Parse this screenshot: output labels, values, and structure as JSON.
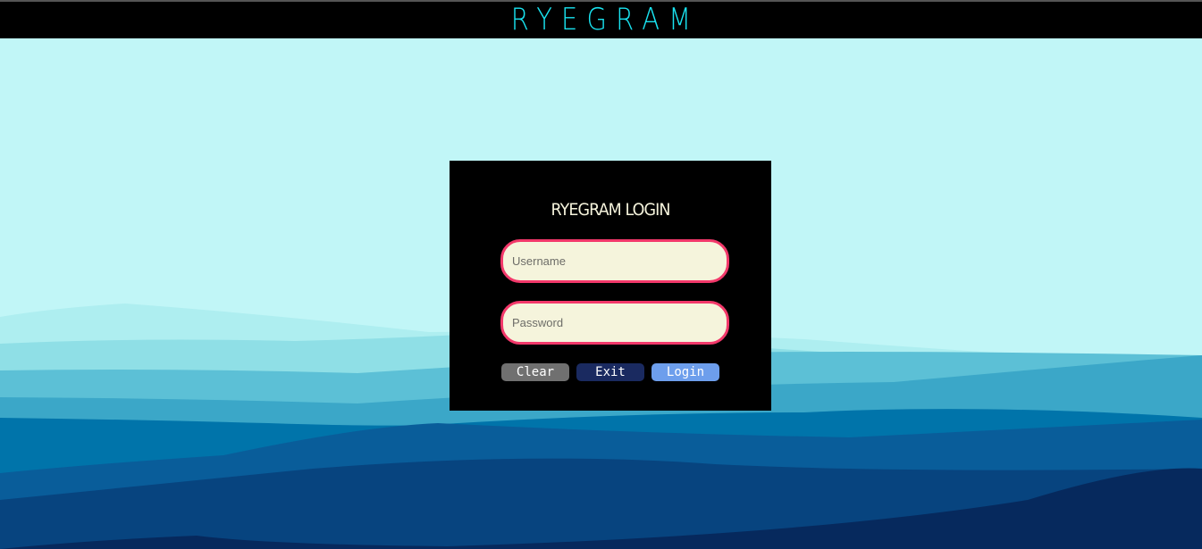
{
  "header": {
    "brand": "RYEGRAM"
  },
  "login": {
    "title": "RYEGRAM LOGIN",
    "username_placeholder": "Username",
    "username_value": "",
    "password_placeholder": "Password",
    "password_value": "",
    "buttons": {
      "clear": "Clear",
      "exit": "Exit",
      "login": "Login"
    }
  },
  "colors": {
    "accent": "#19e3f0",
    "input_border": "#f2386a",
    "login_button": "#6d9eec",
    "exit_button": "#1a2a60",
    "clear_button": "#707070"
  }
}
